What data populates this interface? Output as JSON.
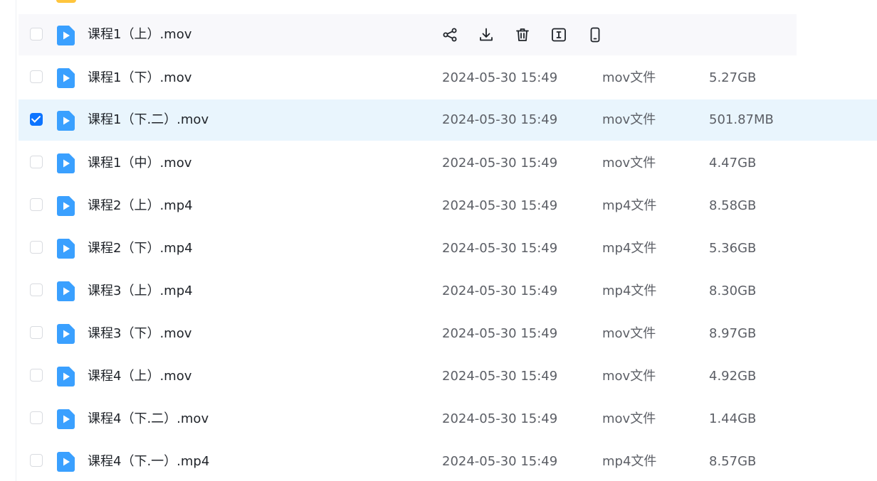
{
  "file_list": {
    "rows": [
      {
        "name": "课程1（上）.mov",
        "checked": false,
        "state": "hovered"
      },
      {
        "name": "课程1（下）.mov",
        "date": "2024-05-30 15:49",
        "type": "mov文件",
        "size": "5.27GB",
        "checked": false,
        "state": "normal"
      },
      {
        "name": "课程1（下.二）.mov",
        "date": "2024-05-30 15:49",
        "type": "mov文件",
        "size": "501.87MB",
        "checked": true,
        "state": "selected"
      },
      {
        "name": "课程1（中）.mov",
        "date": "2024-05-30 15:49",
        "type": "mov文件",
        "size": "4.47GB",
        "checked": false,
        "state": "normal"
      },
      {
        "name": "课程2（上）.mp4",
        "date": "2024-05-30 15:49",
        "type": "mp4文件",
        "size": "8.58GB",
        "checked": false,
        "state": "normal"
      },
      {
        "name": "课程2（下）.mp4",
        "date": "2024-05-30 15:49",
        "type": "mp4文件",
        "size": "5.36GB",
        "checked": false,
        "state": "normal"
      },
      {
        "name": "课程3（上）.mp4",
        "date": "2024-05-30 15:49",
        "type": "mp4文件",
        "size": "8.30GB",
        "checked": false,
        "state": "normal"
      },
      {
        "name": "课程3（下）.mov",
        "date": "2024-05-30 15:49",
        "type": "mov文件",
        "size": "8.97GB",
        "checked": false,
        "state": "normal"
      },
      {
        "name": "课程4（上）.mov",
        "date": "2024-05-30 15:49",
        "type": "mov文件",
        "size": "4.92GB",
        "checked": false,
        "state": "normal"
      },
      {
        "name": "课程4（下.二）.mov",
        "date": "2024-05-30 15:49",
        "type": "mov文件",
        "size": "1.44GB",
        "checked": false,
        "state": "normal"
      },
      {
        "name": "课程4（下.一）.mp4",
        "date": "2024-05-30 15:49",
        "type": "mp4文件",
        "size": "8.57GB",
        "checked": false,
        "state": "normal"
      }
    ],
    "row_actions": [
      "share-icon",
      "download-icon",
      "delete-icon",
      "rename-icon",
      "phone-icon"
    ]
  },
  "colors": {
    "accent": "#0d74ff",
    "selected_row_bg": "#e9f5fd",
    "hover_row_bg": "#f8f8fb",
    "video_icon": "#3aa0ff",
    "folder_icon": "#ffc53d"
  }
}
